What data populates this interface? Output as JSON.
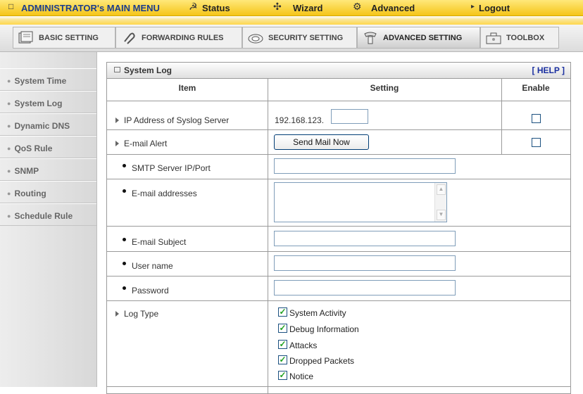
{
  "topbar": {
    "admin_menu": "ADMINISTRATOR's MAIN MENU",
    "status": "Status",
    "wizard": "Wizard",
    "advanced": "Advanced",
    "logout": "Logout"
  },
  "tabs": [
    {
      "label": "BASIC SETTING",
      "icon": "notebook-icon"
    },
    {
      "label": "FORWARDING RULES",
      "icon": "paperclip-icon"
    },
    {
      "label": "SECURITY SETTING",
      "icon": "lock-icon"
    },
    {
      "label": "ADVANCED SETTING",
      "icon": "gears-icon",
      "active": true
    },
    {
      "label": "TOOLBOX",
      "icon": "toolbox-icon"
    }
  ],
  "sidebar": {
    "items": [
      {
        "label": "System Time"
      },
      {
        "label": "System Log"
      },
      {
        "label": "Dynamic DNS"
      },
      {
        "label": "QoS Rule"
      },
      {
        "label": "SNMP"
      },
      {
        "label": "Routing"
      },
      {
        "label": "Schedule Rule"
      }
    ]
  },
  "panel": {
    "title": "System Log",
    "help": "[ HELP ]",
    "headers": {
      "item": "Item",
      "setting": "Setting",
      "enable": "Enable"
    },
    "syslog": {
      "label": "IP Address of Syslog Server",
      "prefix": "192.168.123.",
      "value": "",
      "enabled": false
    },
    "email_alert": {
      "label": "E-mail Alert",
      "button": "Send Mail Now",
      "enabled": false
    },
    "smtp": {
      "label": "SMTP Server IP/Port",
      "value": ""
    },
    "addresses": {
      "label": "E-mail addresses",
      "value": ""
    },
    "subject": {
      "label": "E-mail Subject",
      "value": ""
    },
    "username": {
      "label": "User name",
      "value": ""
    },
    "password": {
      "label": "Password",
      "value": ""
    },
    "log_type": {
      "label": "Log Type",
      "options": [
        {
          "label": "System Activity",
          "checked": true
        },
        {
          "label": "Debug Information",
          "checked": true
        },
        {
          "label": "Attacks",
          "checked": true
        },
        {
          "label": "Dropped Packets",
          "checked": true
        },
        {
          "label": "Notice",
          "checked": true
        }
      ]
    }
  },
  "colors": {
    "menu_yellow": "#f5c518",
    "help_blue": "#1a2fa0",
    "check_green": "#21a121",
    "admin_blue": "#1c3d8c"
  }
}
